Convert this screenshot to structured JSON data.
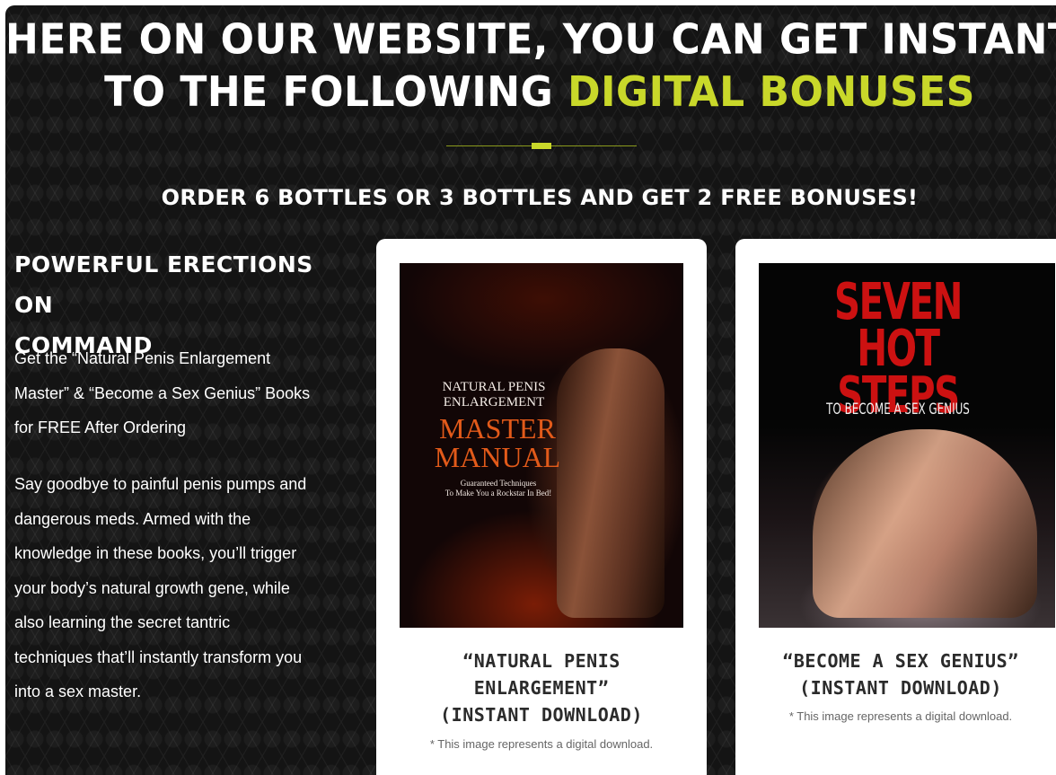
{
  "header": {
    "line1": "HERE ON OUR WEBSITE, YOU CAN GET INSTANT ACCESS",
    "line2_lead": "TO THE FOLLOWING",
    "line2_accent": "DIGITAL BONUSES"
  },
  "subhead": "ORDER 6 BOTTLES OR 3 BOTTLES AND GET 2 FREE BONUSES!",
  "left": {
    "title_line1": "POWERFUL ERECTIONS ON",
    "title_line2": "COMMAND",
    "p1": "Get the “Natural Penis Enlargement Master” & “Become a Sex Genius” Books for FREE After Ordering",
    "p2": "Say goodbye to painful penis pumps and dangerous meds. Armed with the knowledge in these books, you’ll trigger your body’s natural growth gene, while also learning the secret tantric techniques that’ll instantly transform you into a sex master."
  },
  "cards": [
    {
      "cover_top_line1": "NATURAL PENIS",
      "cover_top_line2": "ENLARGEMENT",
      "cover_main_line1": "MASTER",
      "cover_main_line2": "MANUAL",
      "cover_tag_line1": "Guaranteed Techniques",
      "cover_tag_line2": "To Make You a Rockstar In Bed!",
      "title_line1": "“NATURAL PENIS",
      "title_line2": "ENLARGEMENT”",
      "title_line3": "(INSTANT DOWNLOAD)",
      "note": "* This image represents a digital download."
    },
    {
      "cover_big_line1": "SEVEN",
      "cover_big_line2": "HOT STEPS",
      "cover_small": "TO BECOME A SEX GENIUS",
      "title_line1": "“BECOME A SEX GENIUS”",
      "title_line2": "(INSTANT DOWNLOAD)",
      "note": "* This image represents a digital download."
    }
  ],
  "colors": {
    "accent": "#c9d82a",
    "background": "#141414",
    "card": "#ffffff"
  }
}
